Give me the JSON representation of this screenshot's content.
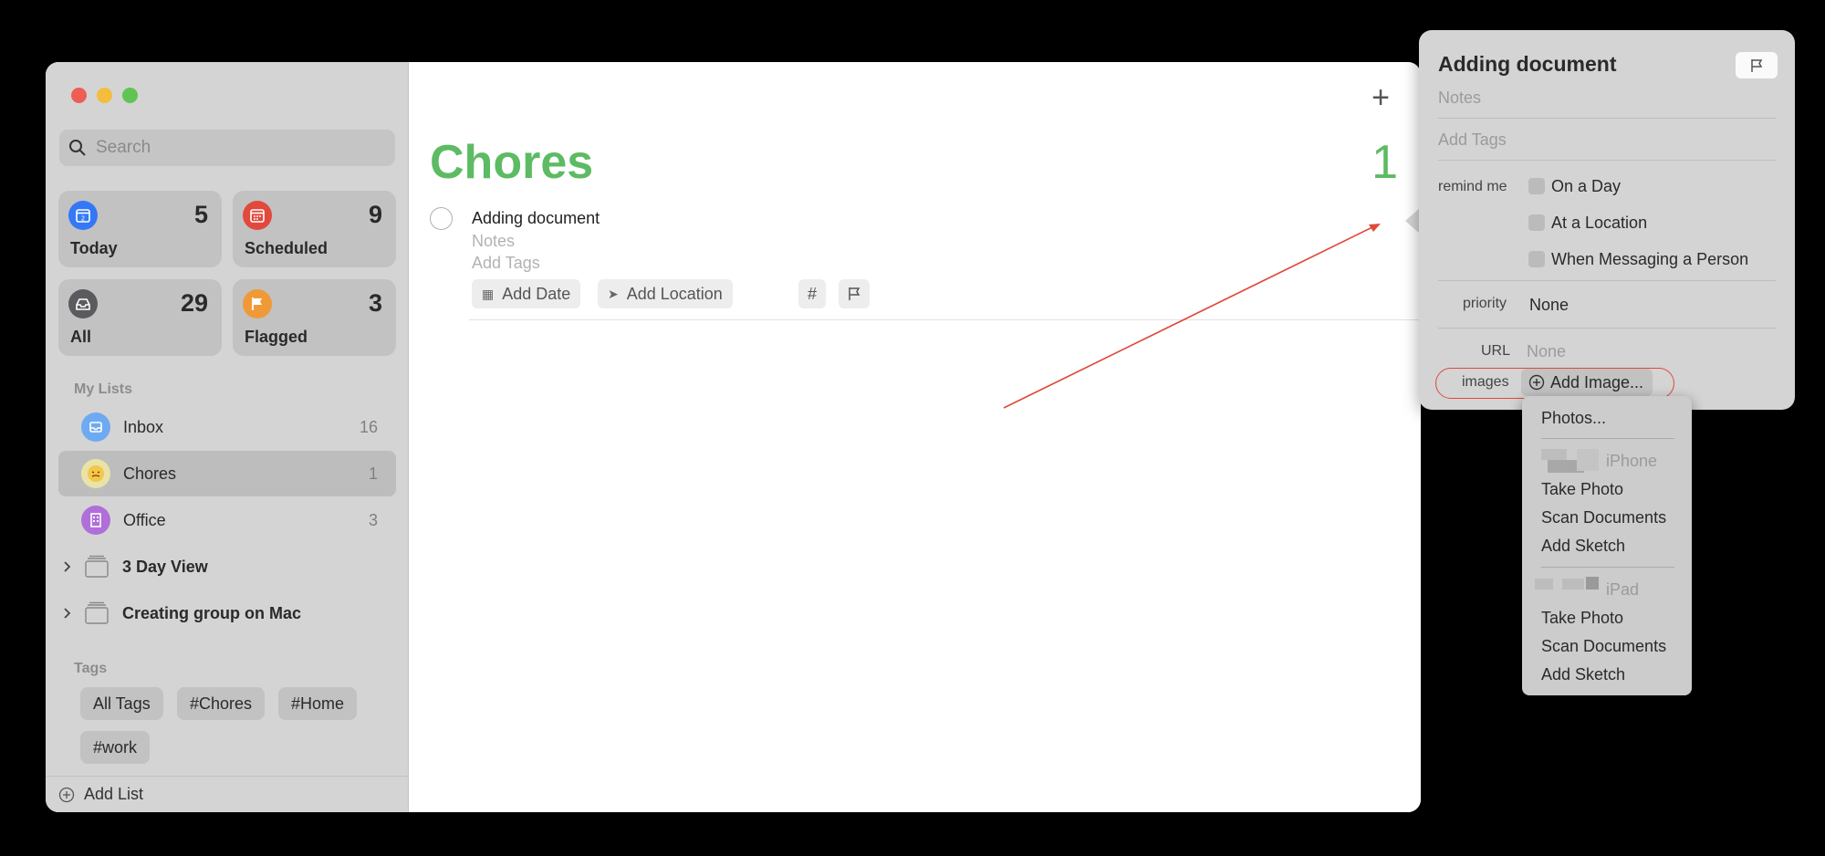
{
  "sidebar": {
    "search_placeholder": "Search",
    "smart_lists": [
      {
        "label": "Today",
        "count": "5",
        "icon": "calendar-today-icon",
        "color": "#3478f6",
        "glyph": "2"
      },
      {
        "label": "Scheduled",
        "count": "9",
        "icon": "calendar-scheduled-icon",
        "color": "#e2493d",
        "glyph": "▦"
      },
      {
        "label": "All",
        "count": "29",
        "icon": "inbox-tray-icon",
        "color": "#5b5b5f",
        "glyph": "▭"
      },
      {
        "label": "Flagged",
        "count": "3",
        "icon": "flag-icon",
        "color": "#f09a37",
        "glyph": "⚑"
      }
    ],
    "my_lists_label": "My Lists",
    "lists": [
      {
        "label": "Inbox",
        "count": "16",
        "icon": "inbox-icon",
        "color": "#6eaaf2"
      },
      {
        "label": "Chores",
        "count": "1",
        "icon": "chores-emoji-icon",
        "color": "#e9e3a6"
      },
      {
        "label": "Office",
        "count": "3",
        "icon": "office-building-icon",
        "color": "#b06fd8"
      }
    ],
    "groups": [
      {
        "label": "3 Day View"
      },
      {
        "label": "Creating group on Mac"
      }
    ],
    "tags_label": "Tags",
    "tags": [
      "All Tags",
      "#Chores",
      "#Home",
      "#work"
    ],
    "add_list_label": "Add List"
  },
  "main": {
    "title": "Chores",
    "count": "1",
    "task": {
      "title": "Adding document",
      "notes_placeholder": "Notes",
      "tags_placeholder": "Add Tags",
      "chips": [
        "Add Date",
        "Add Location",
        "#"
      ]
    }
  },
  "panel": {
    "title": "Adding document",
    "notes_placeholder": "Notes",
    "tags_placeholder": "Add Tags",
    "remind_me_label": "remind me",
    "remind_options": [
      "On a Day",
      "At a Location",
      "When Messaging a Person"
    ],
    "priority_label": "priority",
    "priority_value": "None",
    "url_label": "URL",
    "url_value": "None",
    "images_label": "images",
    "add_image_label": "Add Image..."
  },
  "image_menu": {
    "photos": "Photos...",
    "device1": "iPhone",
    "device1_items": [
      "Take Photo",
      "Scan Documents",
      "Add Sketch"
    ],
    "device2": "iPad",
    "device2_items": [
      "Take Photo",
      "Scan Documents",
      "Add Sketch"
    ]
  },
  "colors": {
    "accent_green": "#5dbb63",
    "annotation_red": "#e0493a"
  }
}
